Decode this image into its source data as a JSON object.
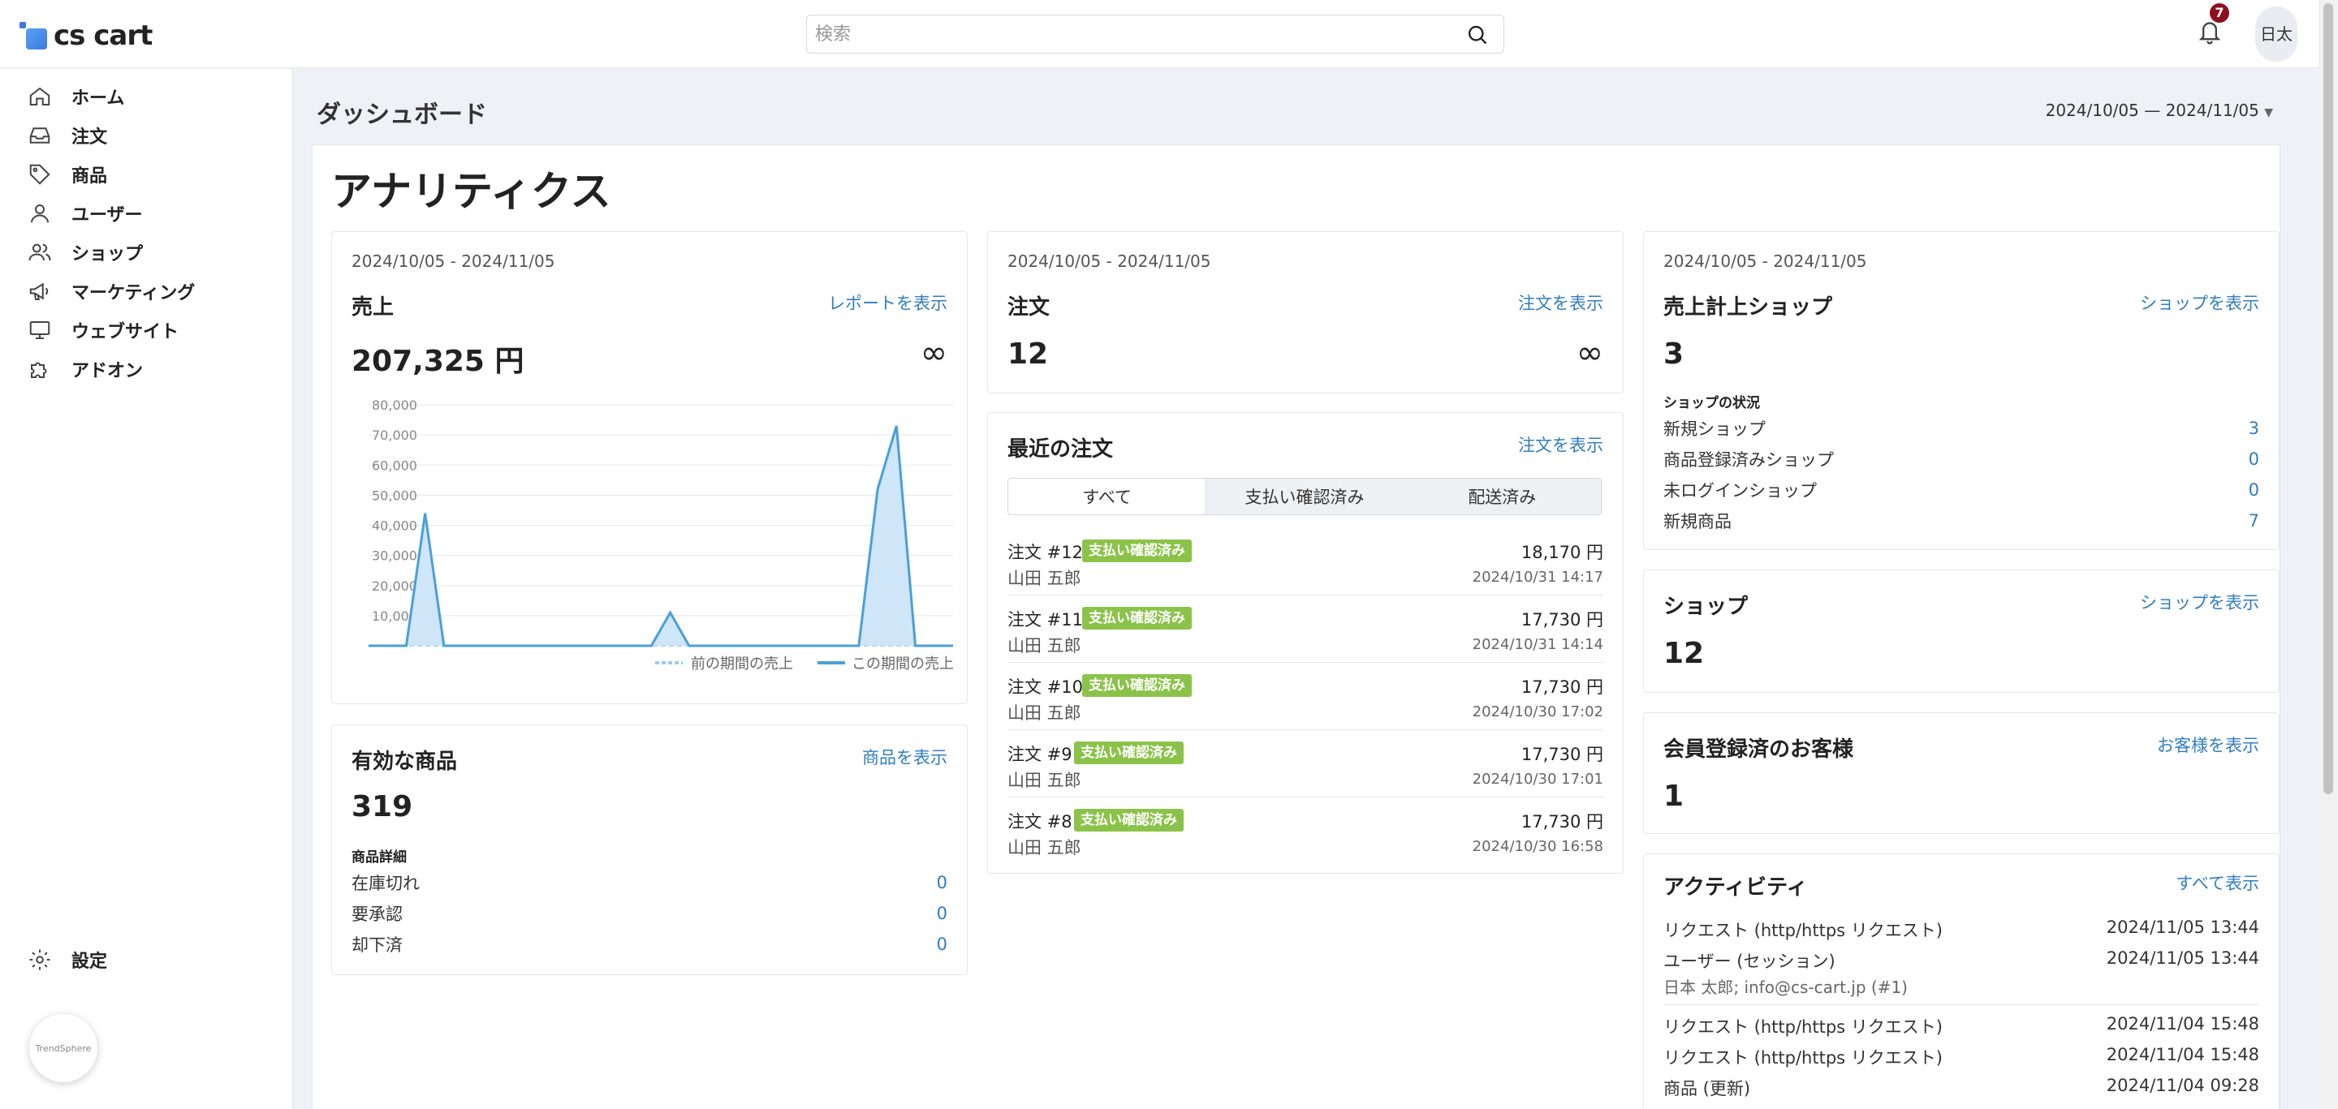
{
  "app": {
    "logo_text": "cs cart"
  },
  "search": {
    "placeholder": "検索"
  },
  "header": {
    "notification_count": "7",
    "user_label": "日太"
  },
  "sidebar": {
    "items": [
      {
        "label": "ホーム",
        "icon": "home-icon"
      },
      {
        "label": "注文",
        "icon": "inbox-icon"
      },
      {
        "label": "商品",
        "icon": "tag-icon"
      },
      {
        "label": "ユーザー",
        "icon": "user-icon"
      },
      {
        "label": "ショップ",
        "icon": "users-icon"
      },
      {
        "label": "マーケティング",
        "icon": "megaphone-icon"
      },
      {
        "label": "ウェブサイト",
        "icon": "monitor-icon"
      },
      {
        "label": "アドオン",
        "icon": "puzzle-icon"
      }
    ],
    "settings_label": "設定",
    "help_label": "TrendSphere"
  },
  "page": {
    "title": "ダッシュボード",
    "date_range": "2024/10/05 — 2024/11/05",
    "section_title": "アナリティクス"
  },
  "sales": {
    "date": "2024/10/05 - 2024/11/05",
    "title": "売上",
    "link": "レポートを表示",
    "value": "207,325 円",
    "infinity": "∞"
  },
  "chart_data": {
    "type": "area",
    "ylim": [
      0,
      80000
    ],
    "yticks": [
      "10,000",
      "20,000",
      "30,000",
      "40,000",
      "50,000",
      "60,000",
      "70,000",
      "80,000"
    ],
    "series": [
      {
        "name": "前の期間の売上",
        "values": [
          0,
          0,
          0,
          0,
          0,
          0,
          0,
          0,
          0,
          0,
          0,
          0,
          0,
          0,
          0,
          0,
          0,
          0,
          0,
          0,
          0,
          0,
          0,
          0,
          0,
          0,
          0,
          0,
          0,
          0,
          0,
          0
        ]
      },
      {
        "name": "この期間の売上",
        "values": [
          0,
          0,
          0,
          44000,
          0,
          0,
          0,
          0,
          0,
          0,
          0,
          0,
          0,
          0,
          0,
          0,
          11000,
          0,
          0,
          0,
          0,
          0,
          0,
          0,
          0,
          0,
          0,
          52000,
          73000,
          0,
          0,
          0
        ]
      }
    ]
  },
  "products": {
    "title": "有効な商品",
    "link": "商品を表示",
    "value": "319",
    "details_heading": "商品詳細",
    "rows": [
      {
        "label": "在庫切れ",
        "value": "0"
      },
      {
        "label": "要承認",
        "value": "0"
      },
      {
        "label": "却下済",
        "value": "0"
      }
    ]
  },
  "orders_card": {
    "date": "2024/10/05 - 2024/11/05",
    "title": "注文",
    "link": "注文を表示",
    "value": "12",
    "infinity": "∞"
  },
  "recent_orders": {
    "title": "最近の注文",
    "link": "注文を表示",
    "tabs": [
      "すべて",
      "支払い確認済み",
      "配送済み"
    ],
    "orders": [
      {
        "number": "注文 #12",
        "status": "支払い確認済み",
        "customer": "山田 五郎",
        "amount": "18,170 円",
        "date": "2024/10/31 14:17"
      },
      {
        "number": "注文 #11",
        "status": "支払い確認済み",
        "customer": "山田 五郎",
        "amount": "17,730 円",
        "date": "2024/10/31 14:14"
      },
      {
        "number": "注文 #10",
        "status": "支払い確認済み",
        "customer": "山田 五郎",
        "amount": "17,730 円",
        "date": "2024/10/30 17:02"
      },
      {
        "number": "注文 #9",
        "status": "支払い確認済み",
        "customer": "山田 五郎",
        "amount": "17,730 円",
        "date": "2024/10/30 17:01"
      },
      {
        "number": "注文 #8",
        "status": "支払い確認済み",
        "customer": "山田 五郎",
        "amount": "17,730 円",
        "date": "2024/10/30 16:58"
      }
    ]
  },
  "selling_shops": {
    "date": "2024/10/05 - 2024/11/05",
    "title": "売上計上ショップ",
    "link": "ショップを表示",
    "value": "3",
    "status_heading": "ショップの状況",
    "rows": [
      {
        "label": "新規ショップ",
        "value": "3"
      },
      {
        "label": "商品登録済みショップ",
        "value": "0"
      },
      {
        "label": "未ログインショップ",
        "value": "0"
      },
      {
        "label": "新規商品",
        "value": "7"
      }
    ]
  },
  "shops": {
    "title": "ショップ",
    "link": "ショップを表示",
    "value": "12"
  },
  "customers": {
    "title": "会員登録済のお客様",
    "link": "お客様を表示",
    "value": "1"
  },
  "activity": {
    "title": "アクティビティ",
    "link": "すべて表示",
    "rows": [
      {
        "label": "リクエスト (http/https リクエスト)",
        "date": "2024/11/05 13:44"
      },
      {
        "label": "ユーザー (セッション)",
        "date": "2024/11/05 13:44",
        "sub": "日本 太郎; info@cs-cart.jp (#1)"
      },
      {
        "label": "リクエスト (http/https リクエスト)",
        "date": "2024/11/04 15:48"
      },
      {
        "label": "リクエスト (http/https リクエスト)",
        "date": "2024/11/04 15:48"
      },
      {
        "label": "商品 (更新)",
        "date": "2024/11/04 09:28"
      }
    ]
  }
}
